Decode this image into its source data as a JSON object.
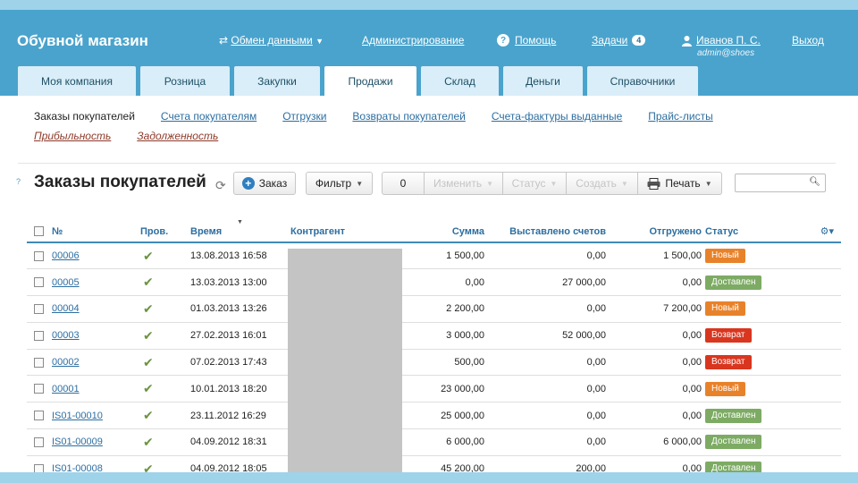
{
  "header": {
    "brand": "Обувной магазин",
    "nav": {
      "exchange": "Обмен данными",
      "admin": "Администрирование",
      "help": "Помощь",
      "help_icon": "?",
      "tasks": "Задачи",
      "tasks_count": "4",
      "user_name": "Иванов П. С.",
      "user_login": "admin@shoes",
      "logout": "Выход"
    },
    "colors": {
      "header_bg": "#4aa3cc",
      "tab_bg": "#d9eef8"
    }
  },
  "tabs": [
    {
      "label": "Моя компания",
      "active": false
    },
    {
      "label": "Розница",
      "active": false
    },
    {
      "label": "Закупки",
      "active": false
    },
    {
      "label": "Продажи",
      "active": true
    },
    {
      "label": "Склад",
      "active": false
    },
    {
      "label": "Деньги",
      "active": false
    },
    {
      "label": "Справочники",
      "active": false
    }
  ],
  "subnav": {
    "current": "Заказы покупателей",
    "links": [
      "Счета покупателям",
      "Отгрузки",
      "Возвраты покупателей",
      "Счета-фактуры выданные",
      "Прайс-листы"
    ],
    "links2": [
      "Прибыльность",
      "Задолженность"
    ]
  },
  "toolbar": {
    "help_mark": "?",
    "title": "Заказы покупателей",
    "refresh_icon": "⟳",
    "order_label": "Заказ",
    "filter_label": "Фильтр",
    "selected_count": "0",
    "edit_label": "Изменить",
    "status_label": "Статус",
    "create_label": "Создать",
    "print_label": "Печать",
    "search_value": "",
    "search_icon": "magnifier-icon"
  },
  "table": {
    "columns": {
      "number": "№",
      "checked": "Пров.",
      "time": "Время",
      "contractor": "Контрагент",
      "sum": "Сумма",
      "invoiced": "Выставлено счетов",
      "shipped": "Отгружено",
      "status": "Статус"
    },
    "status_colors": {
      "Новый": "#e8822a",
      "Доставлен": "#7dab64",
      "Возврат": "#d9361f"
    },
    "rows": [
      {
        "number": "00006",
        "time": "13.08.2013 16:58",
        "sum": "1 500,00",
        "invoiced": "0,00",
        "shipped": "1 500,00",
        "status": "Новый"
      },
      {
        "number": "00005",
        "time": "13.03.2013 13:00",
        "sum": "0,00",
        "invoiced": "27 000,00",
        "shipped": "0,00",
        "status": "Доставлен"
      },
      {
        "number": "00004",
        "time": "01.03.2013 13:26",
        "sum": "2 200,00",
        "invoiced": "0,00",
        "shipped": "7 200,00",
        "status": "Новый"
      },
      {
        "number": "00003",
        "time": "27.02.2013 16:01",
        "sum": "3 000,00",
        "invoiced": "52 000,00",
        "shipped": "0,00",
        "status": "Возврат"
      },
      {
        "number": "00002",
        "time": "07.02.2013 17:43",
        "sum": "500,00",
        "invoiced": "0,00",
        "shipped": "0,00",
        "status": "Возврат"
      },
      {
        "number": "00001",
        "time": "10.01.2013 18:20",
        "sum": "23 000,00",
        "invoiced": "0,00",
        "shipped": "0,00",
        "status": "Новый"
      },
      {
        "number": "IS01-00010",
        "time": "23.11.2012 16:29",
        "sum": "25 000,00",
        "invoiced": "0,00",
        "shipped": "0,00",
        "status": "Доставлен"
      },
      {
        "number": "IS01-00009",
        "time": "04.09.2012 18:31",
        "sum": "6 000,00",
        "invoiced": "0,00",
        "shipped": "6 000,00",
        "status": "Доставлен"
      },
      {
        "number": "IS01-00008",
        "time": "04.09.2012 18:05",
        "sum": "45 200,00",
        "invoiced": "200,00",
        "shipped": "0,00",
        "status": "Доставлен"
      }
    ]
  }
}
